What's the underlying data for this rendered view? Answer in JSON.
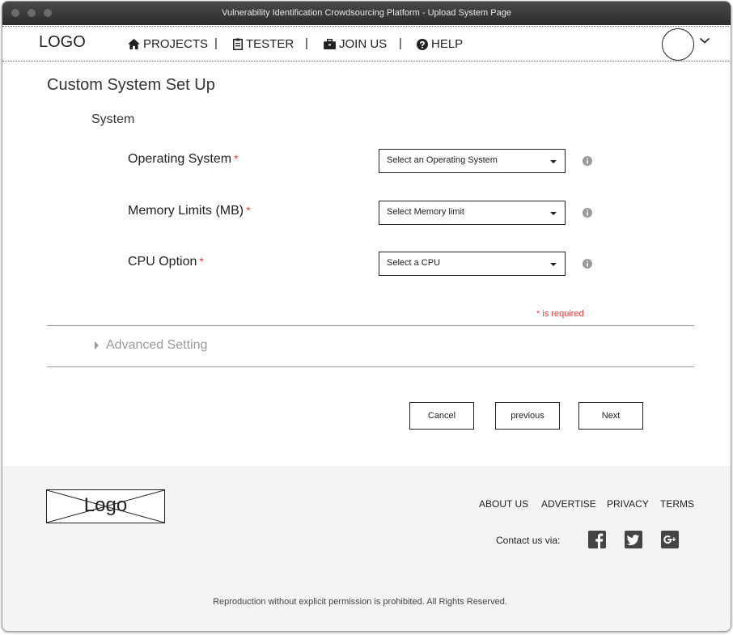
{
  "window": {
    "title": "Vulnerability Identification Crowdsourcing Platform  - Upload System Page"
  },
  "navbar": {
    "logo": "LOGO",
    "items": [
      {
        "label": "PROJECTS",
        "icon": "home-icon"
      },
      {
        "label": "TESTER",
        "icon": "clipboard-icon"
      },
      {
        "label": "JOIN US",
        "icon": "briefcase-icon"
      },
      {
        "label": "HELP",
        "icon": "question-circle-icon"
      }
    ],
    "separator": "|"
  },
  "page": {
    "title": "Custom System Set Up",
    "section": "System",
    "required_marker": "*",
    "fields": [
      {
        "label": "Operating System",
        "placeholder": "Select an Operating System"
      },
      {
        "label": "Memory Limits (MB)",
        "placeholder": "Select Memory limit"
      },
      {
        "label": "CPU Option",
        "placeholder": "Select a CPU"
      }
    ],
    "required_note": "* is required",
    "advanced_label": "Advanced Setting",
    "buttons": {
      "cancel": "Cancel",
      "previous": "previous",
      "next": "Next"
    }
  },
  "footer": {
    "logo": "Logo",
    "links": [
      "ABOUT US",
      "ADVERTISE",
      "PRIVACY",
      "TERMS"
    ],
    "contact_label": "Contact us via:",
    "social": [
      "facebook-icon",
      "twitter-icon",
      "google-plus-icon"
    ],
    "copyright": "Reproduction without explicit permission is prohibited. All Rights Reserved."
  },
  "colors": {
    "required": "#e23b3b",
    "titlebar": "#2c2c2c",
    "footer_bg": "#f4f4f4",
    "muted": "#9a9a9a"
  }
}
